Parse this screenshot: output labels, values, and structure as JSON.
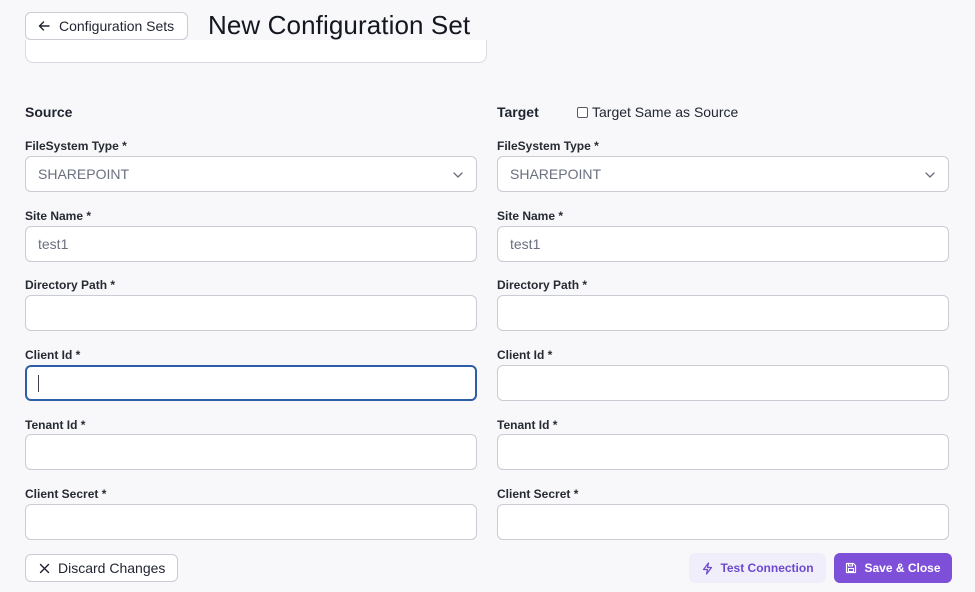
{
  "header": {
    "back_label": "Configuration Sets",
    "title": "New Configuration Set"
  },
  "source": {
    "heading": "Source",
    "filesystem_type": {
      "label": "FileSystem Type *",
      "value": "SHAREPOINT"
    },
    "site_name": {
      "label": "Site Name *",
      "value": "test1"
    },
    "directory_path": {
      "label": "Directory Path *",
      "value": ""
    },
    "client_id": {
      "label": "Client Id *",
      "value": ""
    },
    "tenant_id": {
      "label": "Tenant Id *",
      "value": ""
    },
    "client_secret": {
      "label": "Client Secret *",
      "value": ""
    }
  },
  "target": {
    "heading": "Target",
    "same_as_source_label": "Target Same as Source",
    "same_as_source_checked": false,
    "filesystem_type": {
      "label": "FileSystem Type *",
      "value": "SHAREPOINT"
    },
    "site_name": {
      "label": "Site Name *",
      "value": "test1"
    },
    "directory_path": {
      "label": "Directory Path *",
      "value": ""
    },
    "client_id": {
      "label": "Client Id *",
      "value": ""
    },
    "tenant_id": {
      "label": "Tenant Id *",
      "value": ""
    },
    "client_secret": {
      "label": "Client Secret *",
      "value": ""
    }
  },
  "footer": {
    "discard_label": "Discard Changes",
    "test_label": "Test Connection",
    "save_label": "Save & Close"
  },
  "colors": {
    "accent": "#7e4fd8",
    "accent_text": "#6d48d1",
    "focus_border": "#2f5ea8"
  }
}
